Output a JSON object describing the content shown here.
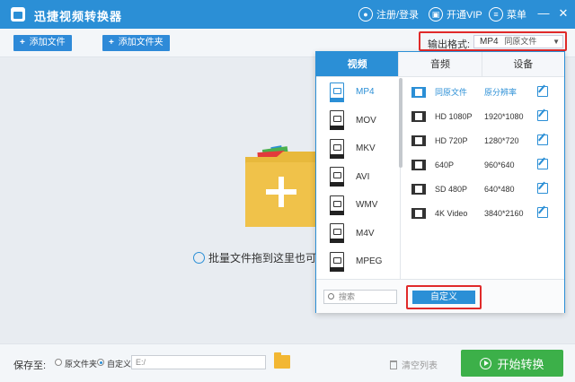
{
  "titlebar": {
    "app_title": "迅捷视频转换器",
    "login_label": "注册/登录",
    "vip_label": "开通VIP",
    "menu_label": "菜单",
    "minimize": "—",
    "close": "✕"
  },
  "toolbar": {
    "add_file_label": "添加文件",
    "add_folder_label": "添加文件夹",
    "plus": "+",
    "output_format_label": "输出格式:",
    "output_format_value": "MP4",
    "output_format_sub": "同原文件",
    "dropdown_arrow": "▼"
  },
  "drop_area": {
    "hint_text": "批量文件拖到这里也可"
  },
  "format_popup": {
    "tabs": [
      {
        "label": "视频",
        "active": true
      },
      {
        "label": "音频",
        "active": false
      },
      {
        "label": "设备",
        "active": false
      }
    ],
    "formats": [
      {
        "label": "MP4",
        "active": true
      },
      {
        "label": "MOV",
        "active": false
      },
      {
        "label": "MKV",
        "active": false
      },
      {
        "label": "AVI",
        "active": false
      },
      {
        "label": "WMV",
        "active": false
      },
      {
        "label": "M4V",
        "active": false
      },
      {
        "label": "MPEG",
        "active": false
      }
    ],
    "resolutions": [
      {
        "name": "同原文件",
        "value": "原分辨率",
        "active": true
      },
      {
        "name": "HD 1080P",
        "value": "1920*1080",
        "active": false
      },
      {
        "name": "HD 720P",
        "value": "1280*720",
        "active": false
      },
      {
        "name": "640P",
        "value": "960*640",
        "active": false
      },
      {
        "name": "SD 480P",
        "value": "640*480",
        "active": false
      },
      {
        "name": "4K Video",
        "value": "3840*2160",
        "active": false
      }
    ],
    "search_placeholder": "搜索",
    "custom_label": "自定义"
  },
  "footer": {
    "save_to_label": "保存至:",
    "option_original": "原文件夹",
    "option_custom": "自定义",
    "path_value": "E:/",
    "clear_list_label": "清空列表",
    "start_label": "开始转换"
  },
  "colors": {
    "accent": "#2b8fd6",
    "highlight_border": "#e02a2a",
    "start_button": "#3cb049",
    "folder": "#f2b733"
  }
}
